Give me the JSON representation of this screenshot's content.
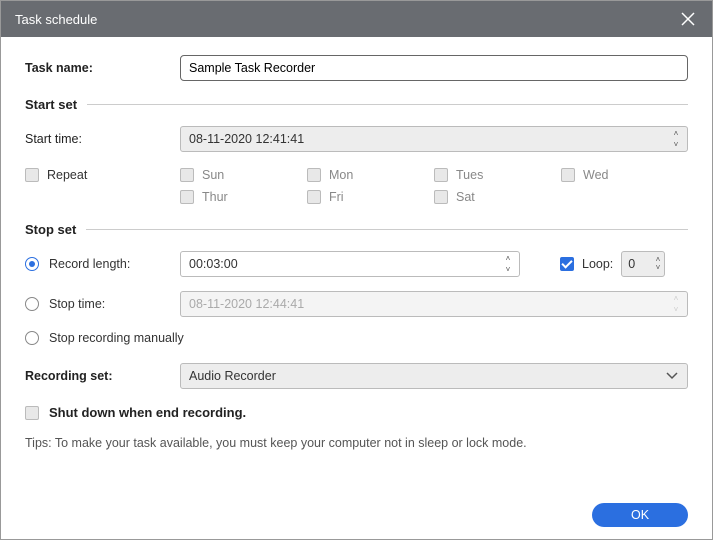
{
  "window": {
    "title": "Task schedule"
  },
  "task_name": {
    "label": "Task name:",
    "value": "Sample Task Recorder"
  },
  "start_set": {
    "header": "Start set",
    "start_time_label": "Start time:",
    "start_time_value": "08-11-2020 12:41:41",
    "repeat_label": "Repeat",
    "days": {
      "sun": "Sun",
      "mon": "Mon",
      "tues": "Tues",
      "wed": "Wed",
      "thur": "Thur",
      "fri": "Fri",
      "sat": "Sat"
    }
  },
  "stop_set": {
    "header": "Stop set",
    "record_length_label": "Record length:",
    "record_length_value": "00:03:00",
    "loop_label": "Loop:",
    "loop_value": "0",
    "stop_time_label": "Stop time:",
    "stop_time_value": "08-11-2020 12:44:41",
    "manual_label": "Stop recording manually",
    "selected": "record_length"
  },
  "recording_set": {
    "label": "Recording set:",
    "value": "Audio Recorder"
  },
  "shutdown": {
    "label": "Shut down when end recording."
  },
  "tips": "Tips: To make your task available, you must keep your computer not in sleep or lock mode.",
  "buttons": {
    "ok": "OK"
  }
}
